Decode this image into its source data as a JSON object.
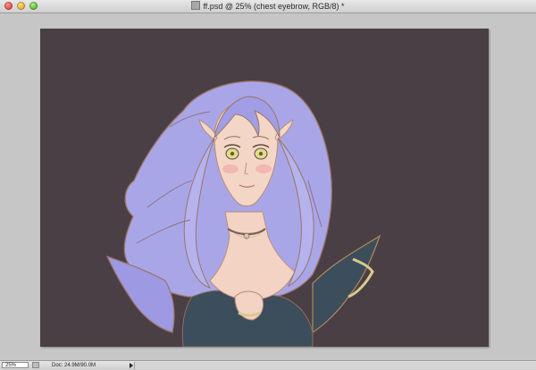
{
  "window": {
    "title": "ff.psd @ 25% (chest  eyebrow, RGB/8) *"
  },
  "statusbar": {
    "zoom": "25%",
    "doc_info": "Doc: 24.9M/90.0M"
  },
  "canvas": {
    "background_color": "#4a3f45",
    "hair_color": "#a9a6e8",
    "skin_color": "#f2d3c4"
  }
}
